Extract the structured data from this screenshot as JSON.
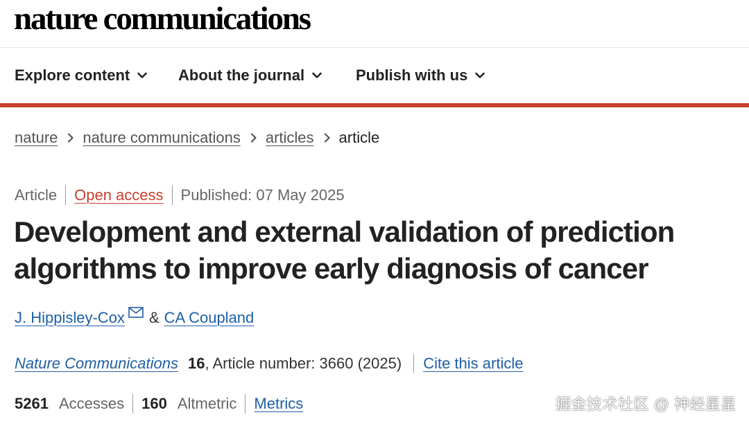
{
  "site": {
    "brand": "nature communications"
  },
  "nav": {
    "items": [
      {
        "label": "Explore content"
      },
      {
        "label": "About the journal"
      },
      {
        "label": "Publish with us"
      }
    ]
  },
  "colors": {
    "accent_red": "#c9402d",
    "link_blue": "#1f5fa6"
  },
  "breadcrumb": {
    "items": [
      {
        "label": "nature"
      },
      {
        "label": "nature communications"
      },
      {
        "label": "articles"
      },
      {
        "label": "article"
      }
    ]
  },
  "article": {
    "type": "Article",
    "access": "Open access",
    "published": "Published: 07 May 2025",
    "title": "Development and external validation of prediction algorithms to improve early diagnosis of cancer",
    "authors": [
      {
        "name": "J. Hippisley-Cox",
        "icon": "mail-icon"
      },
      {
        "name": "CA Coupland"
      }
    ],
    "author_separator": "&",
    "journal": "Nature Communications",
    "volume": "16",
    "citation_rest": ", Article number: 3660 (2025)",
    "cite_label": "Cite this article",
    "metrics": {
      "accesses_value": "5261",
      "accesses_label": "Accesses",
      "altmetric_value": "160",
      "altmetric_label": "Altmetric",
      "metrics_link": "Metrics"
    }
  },
  "watermark": "掘金技术社区 @ 神经星星"
}
